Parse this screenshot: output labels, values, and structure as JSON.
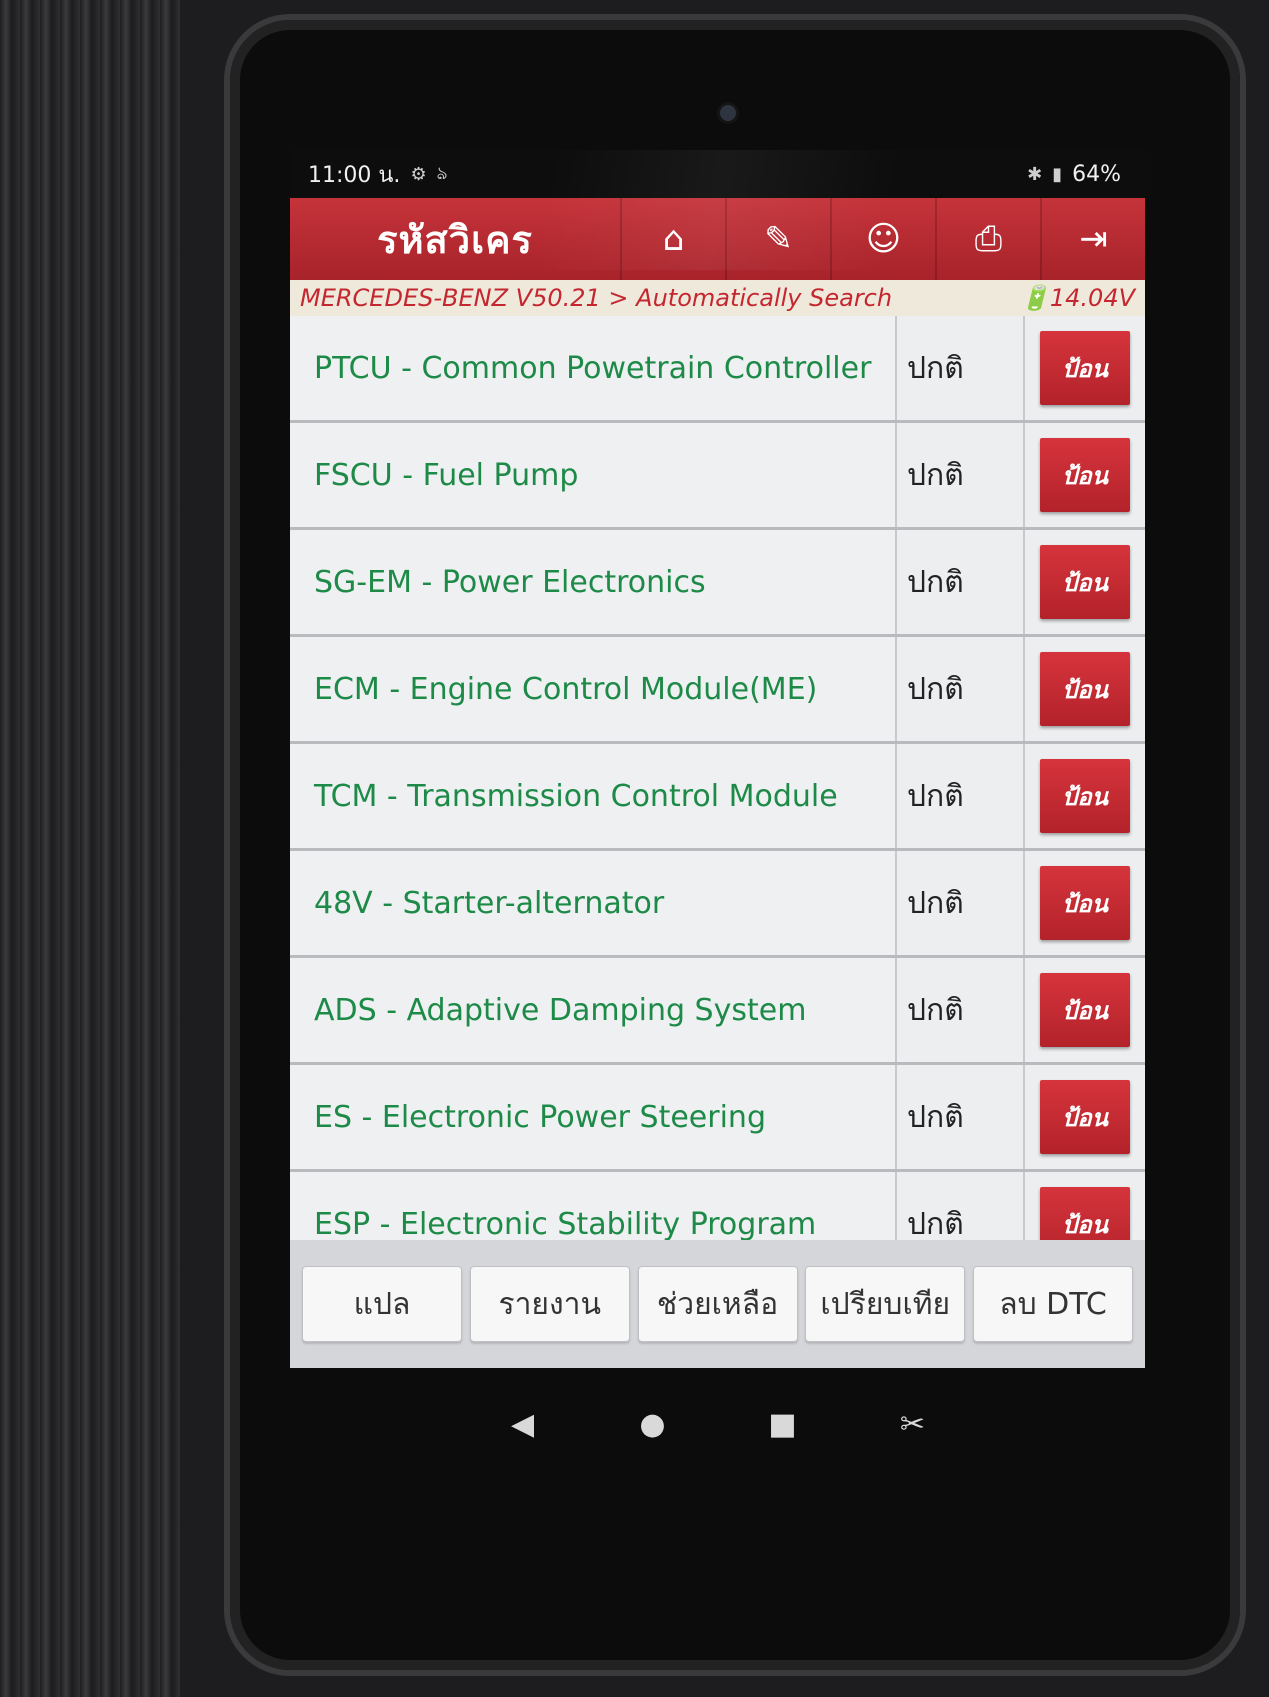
{
  "status_bar": {
    "time": "11:00 น.",
    "icons_left": [
      "settings-icon",
      "vpn-icon"
    ],
    "battery": "64%"
  },
  "toolbar": {
    "title": "รหัสวิเคร",
    "buttons": [
      {
        "name": "home-icon",
        "glyph": "⌂"
      },
      {
        "name": "edit-icon",
        "glyph": "✎"
      },
      {
        "name": "user-icon",
        "glyph": "☺"
      },
      {
        "name": "print-icon",
        "glyph": "⎙"
      },
      {
        "name": "exit-icon",
        "glyph": "⇥"
      }
    ]
  },
  "breadcrumb": {
    "path": "MERCEDES-BENZ V50.21 > Automatically Search",
    "voltage": "14.04V"
  },
  "modules": [
    {
      "name": "PTCU - Common Powetrain Controller",
      "status": "ปกติ",
      "action": "ป้อน"
    },
    {
      "name": "FSCU - Fuel Pump",
      "status": "ปกติ",
      "action": "ป้อน"
    },
    {
      "name": "SG-EM - Power Electronics",
      "status": "ปกติ",
      "action": "ป้อน"
    },
    {
      "name": "ECM - Engine Control Module(ME)",
      "status": "ปกติ",
      "action": "ป้อน"
    },
    {
      "name": "TCM - Transmission Control Module",
      "status": "ปกติ",
      "action": "ป้อน"
    },
    {
      "name": "48V - Starter-alternator",
      "status": "ปกติ",
      "action": "ป้อน"
    },
    {
      "name": "ADS - Adaptive Damping System",
      "status": "ปกติ",
      "action": "ป้อน"
    },
    {
      "name": "ES - Electronic Power Steering",
      "status": "ปกติ",
      "action": "ป้อน"
    },
    {
      "name": "ESP - Electronic Stability Program",
      "status": "ปกติ",
      "action": "ป้อน"
    }
  ],
  "bottom_buttons": {
    "translate": "แปล",
    "report": "รายงาน",
    "help": "ช่วยเหลือ",
    "compare": "เปรียบเทีย",
    "clear_dtc": "ลบ DTC"
  },
  "nav_bar": {
    "back": "◀",
    "home": "●",
    "recents": "■",
    "screenshot": "✂"
  },
  "colors": {
    "accent_red": "#c5333a",
    "module_green": "#1e8a48",
    "breadcrumb_red": "#c4272f"
  }
}
